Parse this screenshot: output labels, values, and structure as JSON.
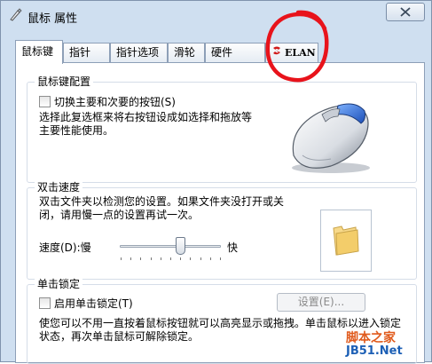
{
  "window": {
    "title": "鼠标 属性"
  },
  "tabs": [
    {
      "label": "鼠标键",
      "active": true
    },
    {
      "label": "指针"
    },
    {
      "label": "指针选项"
    },
    {
      "label": "滑轮"
    },
    {
      "label": "硬件"
    },
    {
      "label": "ELAN"
    }
  ],
  "button_config": {
    "title": "鼠标键配置",
    "switch_label": "切换主要和次要的按钮(S)",
    "switch_checked": false,
    "description": "选择此复选框来将右按钮设成如选择和拖放等主要性能使用。"
  },
  "double_click": {
    "title": "双击速度",
    "description": "双击文件夹以检测您的设置。如果文件夹没打开或关闭，请用慢一点的设置再试一次。",
    "speed_label": "速度(D):慢",
    "fast_label": "快",
    "speed_level": 0.6
  },
  "click_lock": {
    "title": "单击锁定",
    "enable_label": "启用单击锁定(T)",
    "enable_checked": false,
    "settings_button": "设置(E)...",
    "description": "使您可以不用一直按着鼠标按钮就可以高亮显示或拖拽。单击鼠标以进入锁定状态，再次单击鼠标可解除锁定。"
  },
  "watermark": {
    "site_cn": "脚本之家",
    "site_url": "JB51.Net"
  },
  "colors": {
    "window_frame": "#cfdff0",
    "annotation_circle": "#e8131b",
    "watermark_orange": "#e05a1c",
    "watermark_blue": "#1c5fb5"
  },
  "icons": [
    "mouse-app-icon",
    "close-icon",
    "elan-logo-icon",
    "mouse-image",
    "folder-icon"
  ]
}
